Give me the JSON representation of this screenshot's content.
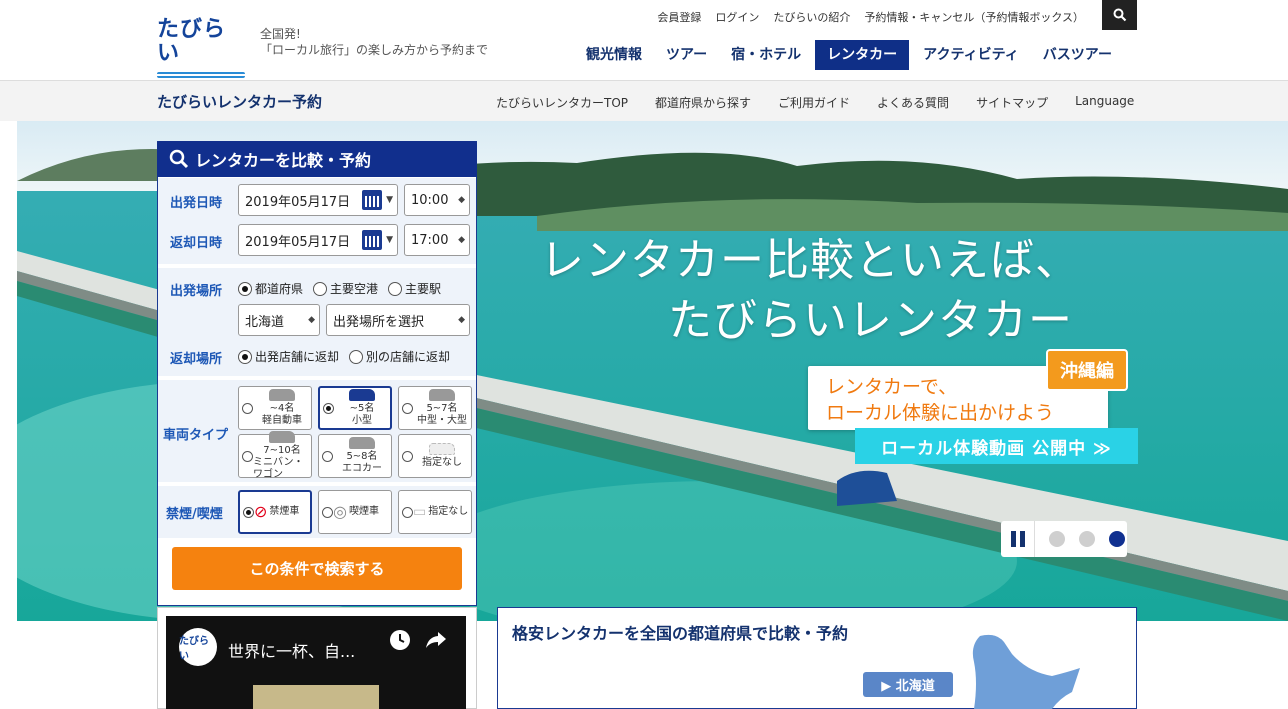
{
  "header": {
    "logo_text": "たびらい",
    "tagline_line1": "全国発!",
    "tagline_line2": "「ローカル旅行」の楽しみ方から予約まで",
    "top_links": [
      "会員登録",
      "ログイン",
      "たびらいの紹介",
      "予約情報・キャンセル（予約情報ボックス）"
    ],
    "search_icon": "search-icon",
    "main_nav": [
      {
        "label": "観光情報",
        "active": false
      },
      {
        "label": "ツアー",
        "active": false
      },
      {
        "label": "宿・ホテル",
        "active": false
      },
      {
        "label": "レンタカー",
        "active": true
      },
      {
        "label": "アクティビティ",
        "active": false
      },
      {
        "label": "バスツアー",
        "active": false
      }
    ]
  },
  "subbar": {
    "title": "たびらいレンタカー予約",
    "links": [
      "たびらいレンタカーTOP",
      "都道府県から探す",
      "ご利用ガイド",
      "よくある質問",
      "サイトマップ",
      "Language"
    ]
  },
  "hero": {
    "headline1": "レンタカー比較といえば、",
    "headline2": "たびらいレンタカー",
    "promo_line1": "レンタカーで、",
    "promo_line2": "ローカル体験に出かけよう",
    "promo_badge": "沖縄編",
    "video_button": "ローカル体験動画 公開中 ≫",
    "slide_count": 3,
    "active_slide": 3
  },
  "search": {
    "title": "レンタカーを比較・予約",
    "depart_label": "出発日時",
    "depart_date": "2019年05月17日",
    "depart_time": "10:00",
    "return_label": "返却日時",
    "return_date": "2019年05月17日",
    "return_time": "17:00",
    "pickup_label": "出発場所",
    "pickup_options": [
      {
        "label": "都道府県",
        "checked": true
      },
      {
        "label": "主要空港",
        "checked": false
      },
      {
        "label": "主要駅",
        "checked": false
      }
    ],
    "prefecture": "北海道",
    "pickup_place": "出発場所を選択",
    "return_place_label": "返却場所",
    "return_options": [
      {
        "label": "出発店舗に返却",
        "checked": true
      },
      {
        "label": "別の店舗に返却",
        "checked": false
      }
    ],
    "car_type_label": "車両タイプ",
    "car_types": [
      {
        "name": "軽自動車",
        "cap": "~4名",
        "checked": false
      },
      {
        "name": "小型",
        "cap": "~5名",
        "checked": true
      },
      {
        "name": "中型・大型",
        "cap": "5~7名",
        "checked": false
      },
      {
        "name": "ミニバン・ワゴン",
        "cap": "7~10名",
        "checked": false
      },
      {
        "name": "エコカー",
        "cap": "5~8名",
        "checked": false
      },
      {
        "name": "指定なし",
        "cap": "",
        "checked": false
      }
    ],
    "smoking_label": "禁煙/喫煙",
    "smoking_options": [
      {
        "name": "禁煙車",
        "checked": true
      },
      {
        "name": "喫煙車",
        "checked": false
      },
      {
        "name": "指定なし",
        "checked": false
      }
    ],
    "submit": "この条件で検索する"
  },
  "video": {
    "channel": "たびらい",
    "title": "世界に一杯、自..."
  },
  "compare": {
    "title": "格安レンタカーを全国の都道府県で比較・予約",
    "region_button": "▶ 北海道"
  },
  "colors": {
    "brand": "#112f8d",
    "accent": "#f5820f",
    "promo": "#f07a10",
    "video_button": "#2ad2e6"
  }
}
